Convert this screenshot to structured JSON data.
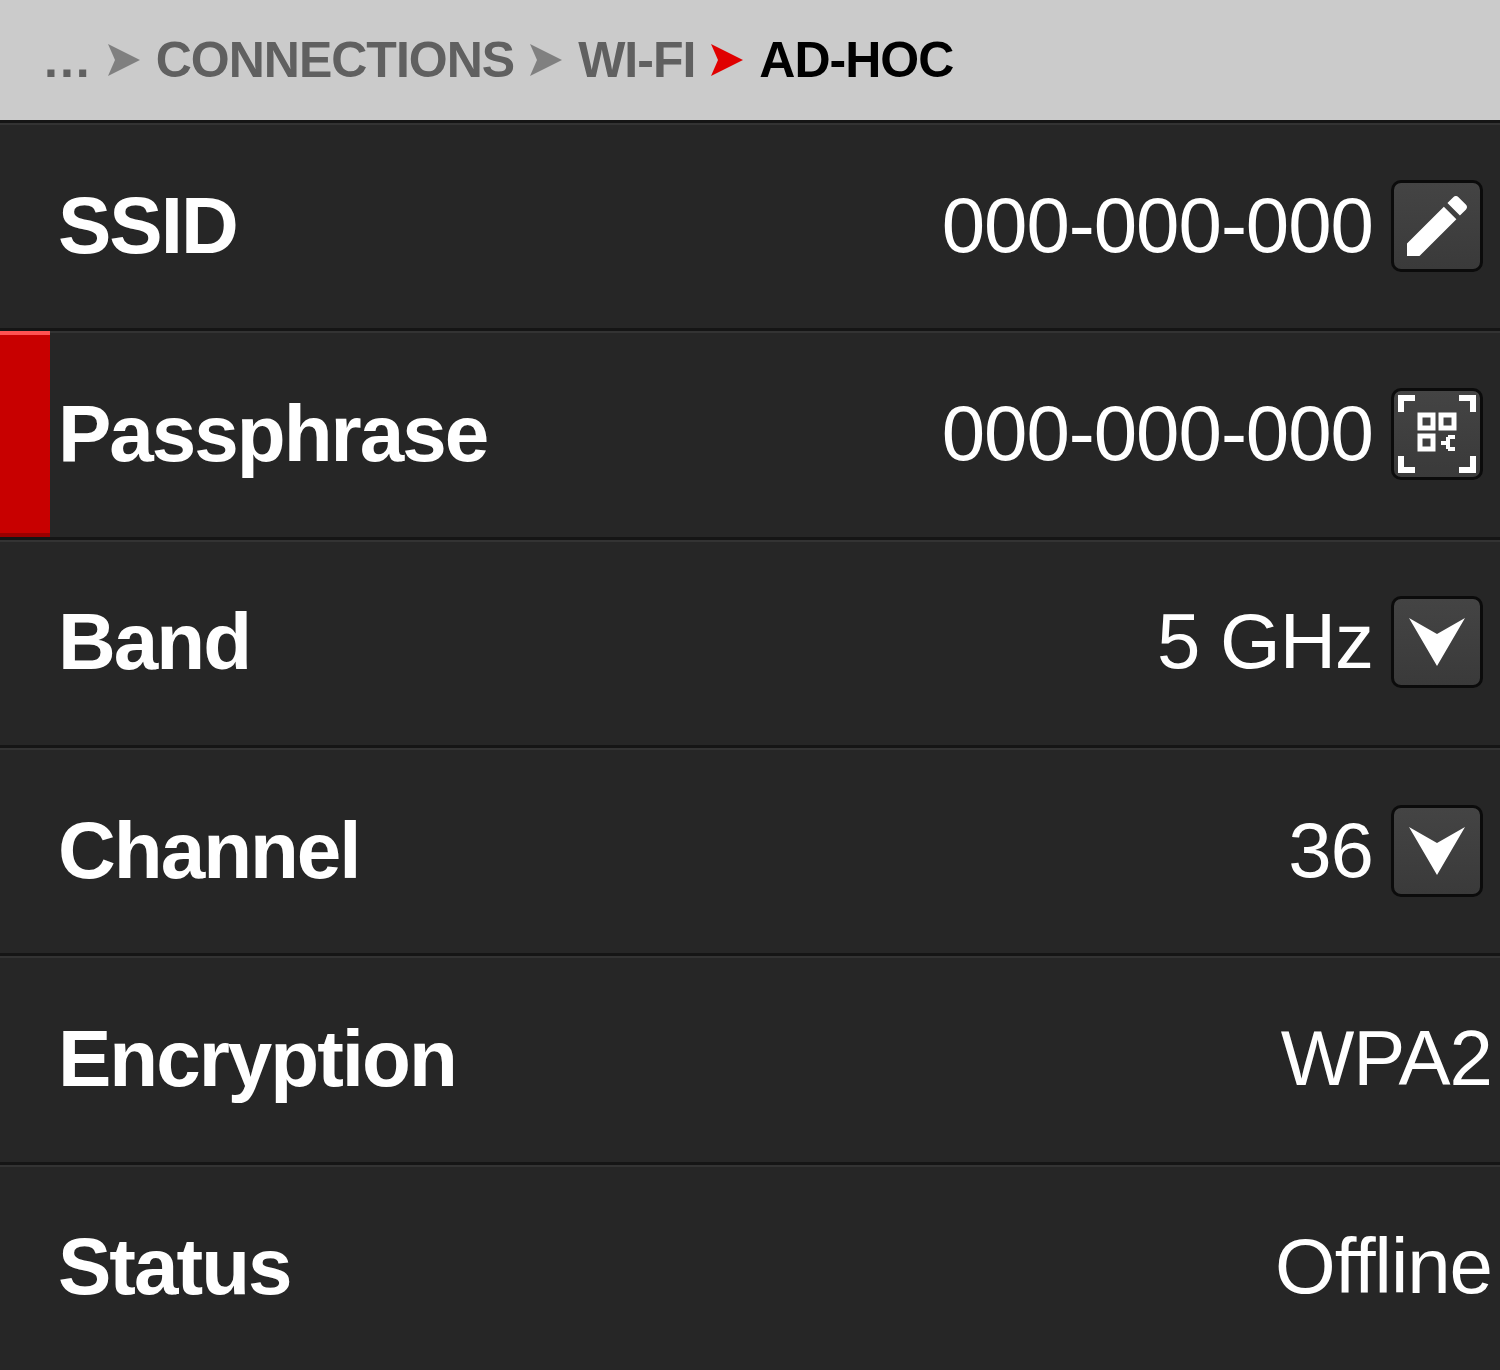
{
  "breadcrumb": [
    {
      "text": "...",
      "selected": false
    },
    {
      "text": "CONNECTIONS",
      "selected": false
    },
    {
      "text": "WI-FI",
      "selected": false
    },
    {
      "text": "AD-HOC",
      "selected": true
    }
  ],
  "settings": [
    {
      "label": "SSID",
      "value": "000-000-000",
      "kind": "edit",
      "selected": false
    },
    {
      "label": "Passphrase",
      "value": "000-000-000",
      "kind": "qr",
      "selected": true
    },
    {
      "label": "Band",
      "value": "5 GHz",
      "kind": "dropdown",
      "selected": false
    },
    {
      "label": "Channel",
      "value": "36",
      "kind": "dropdown",
      "selected": false
    },
    {
      "label": "Encryption",
      "value": "WPA2",
      "kind": "plain",
      "selected": false
    },
    {
      "label": "Status",
      "value": "Offline",
      "kind": "plain",
      "selected": false
    }
  ]
}
